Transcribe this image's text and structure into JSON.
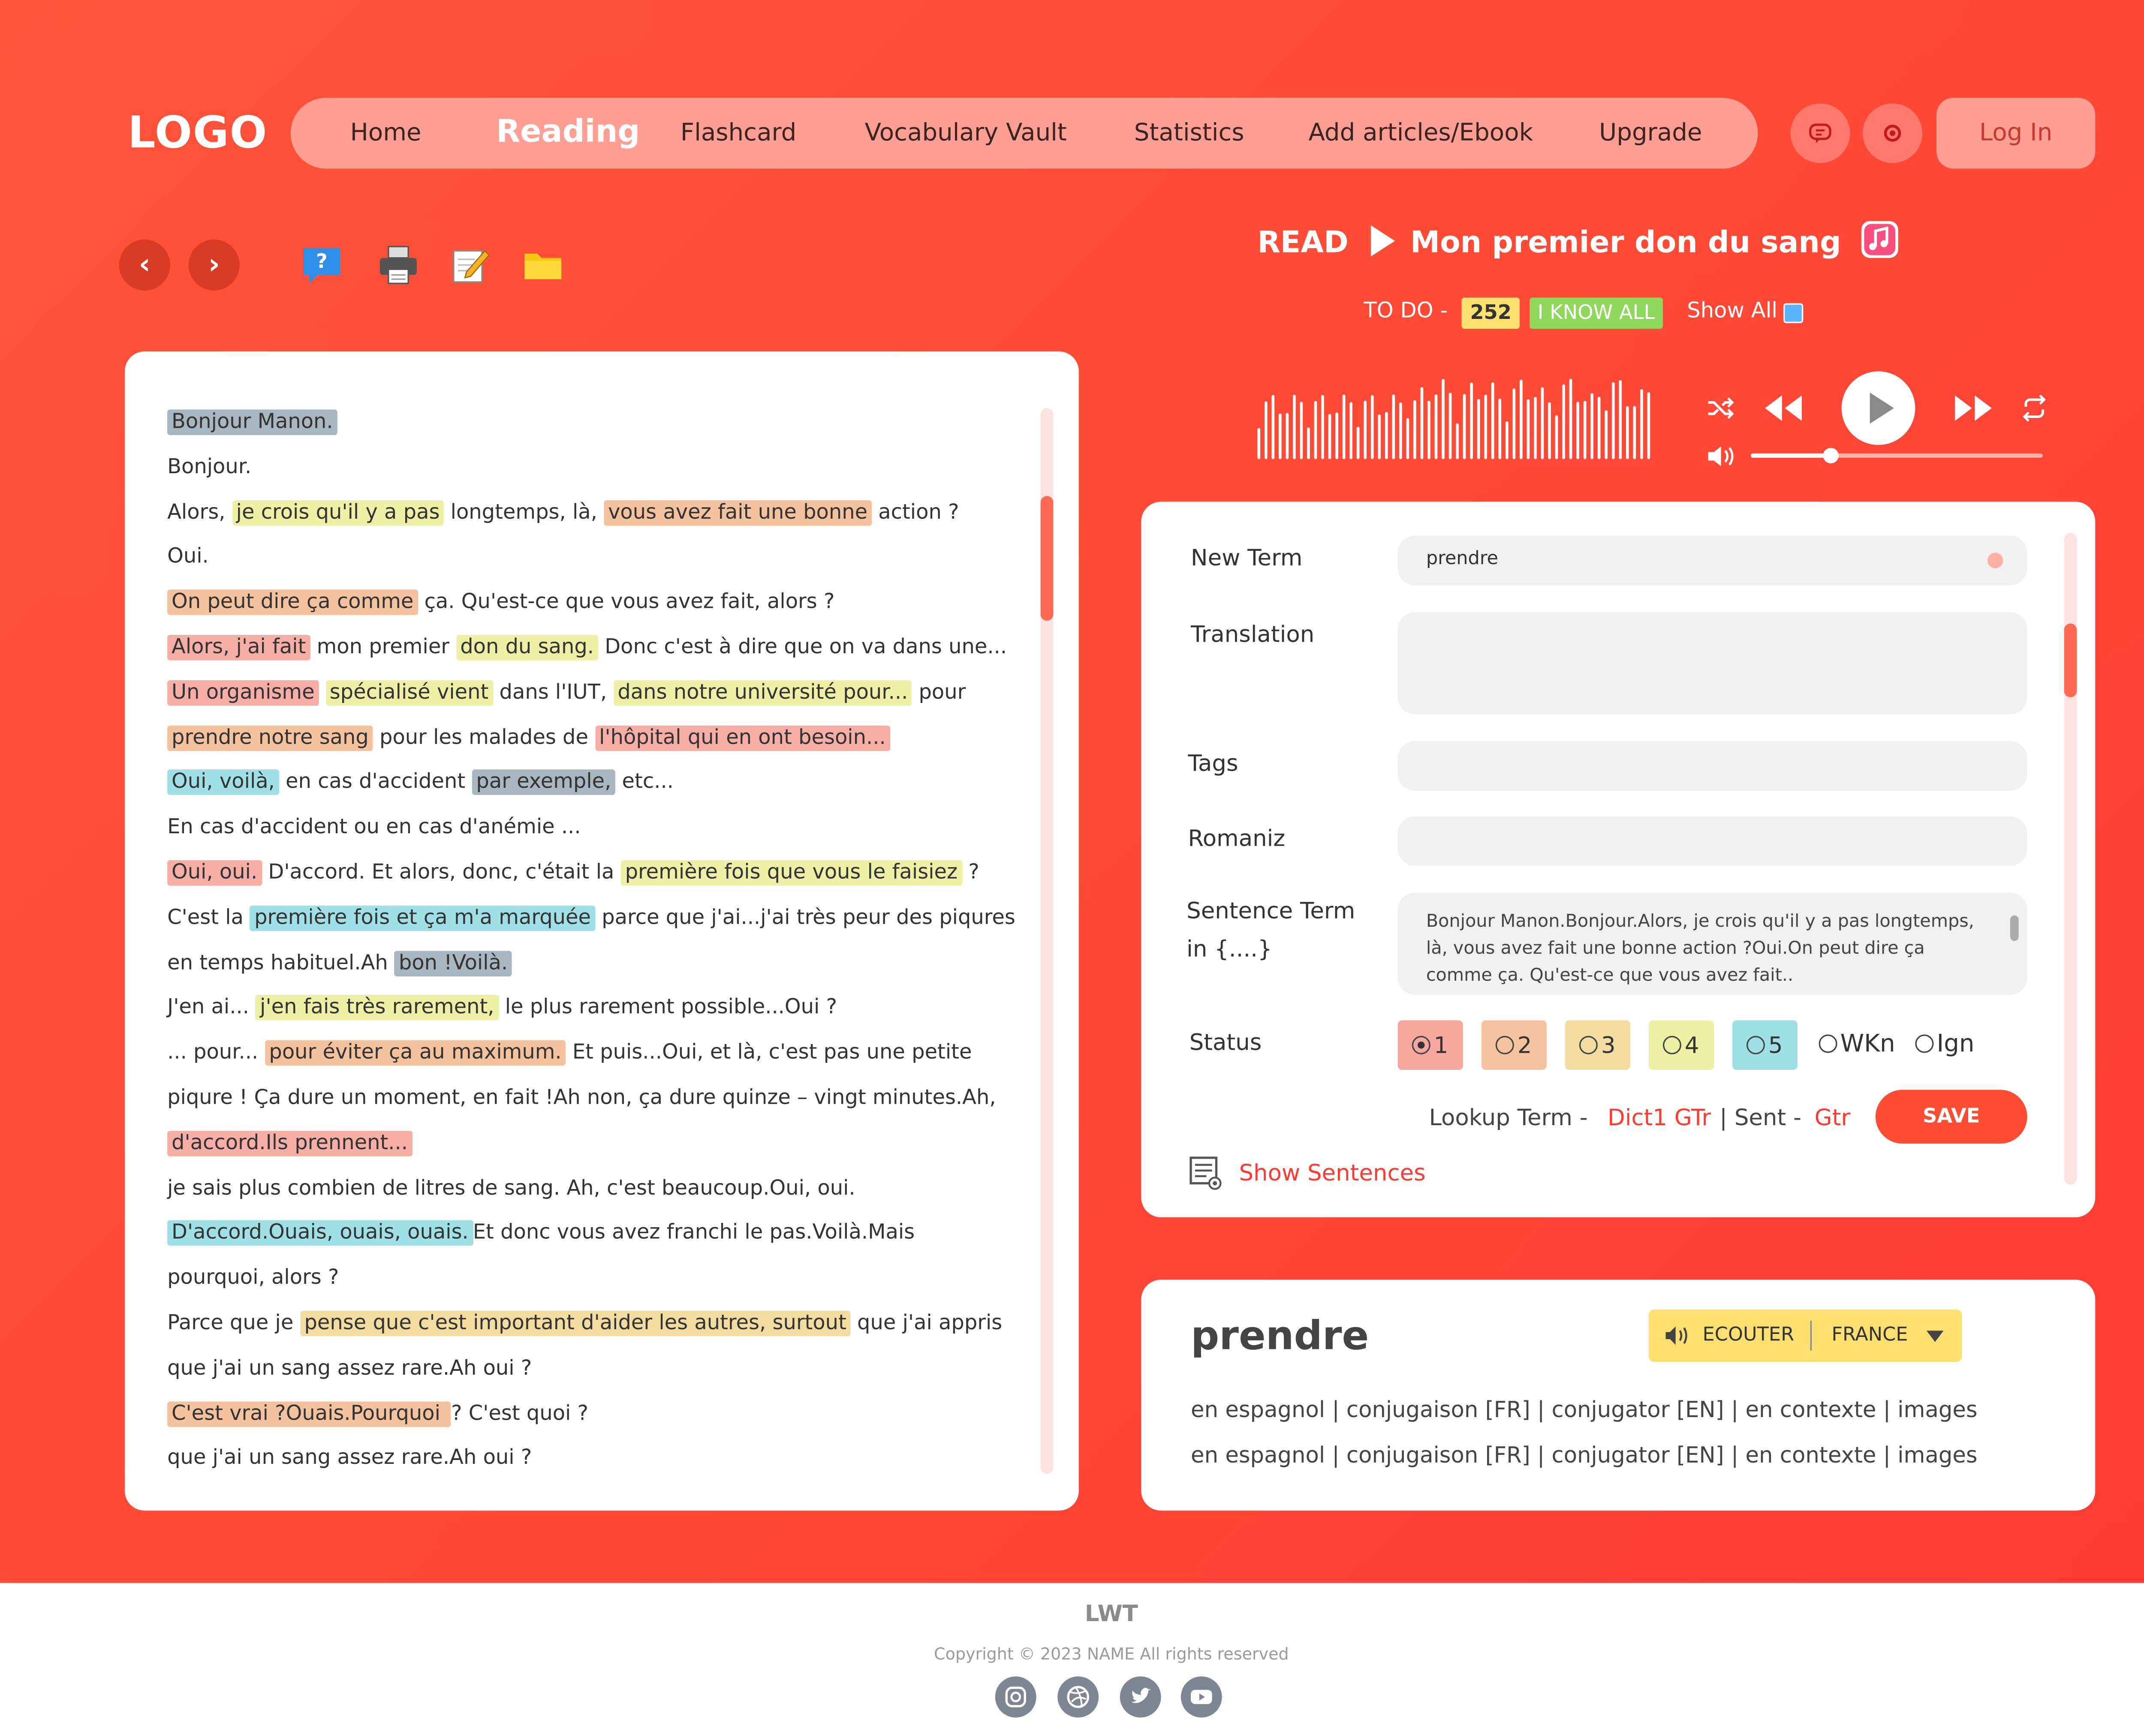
{
  "nav": {
    "logo": "LOGO",
    "items": [
      "Home",
      "Reading",
      "Flashcard",
      "Vocabulary Vault",
      "Statistics",
      "Add articles/Ebook",
      "Upgrade"
    ],
    "active": "Reading",
    "login": "Log In"
  },
  "toolbar": {
    "icons": [
      "prev-arrow-icon",
      "next-arrow-icon",
      "help-icon",
      "printer-icon",
      "edit-icon",
      "folder-icon"
    ]
  },
  "reader": {
    "lines": [
      [
        {
          "t": "Bonjour Manon.",
          "h": "gray"
        }
      ],
      [
        {
          "t": "Bonjour."
        }
      ],
      [
        {
          "t": "Alors, "
        },
        {
          "t": "je crois qu'il y a pas",
          "h": "yellow"
        },
        {
          "t": " longtemps, là, "
        },
        {
          "t": "vous avez fait une bonne",
          "h": "orange"
        },
        {
          "t": " action ?"
        }
      ],
      [
        {
          "t": "Oui."
        }
      ],
      [
        {
          "t": "On peut dire ça comme",
          "h": "orange"
        },
        {
          "t": " ça. Qu'est-ce que vous avez fait, alors ?"
        }
      ],
      [
        {
          "t": "Alors, j'ai fait",
          "h": "pink"
        },
        {
          "t": " mon premier "
        },
        {
          "t": "don du sang.",
          "h": "yellow"
        },
        {
          "t": " Donc c'est à dire que on va dans une..."
        }
      ],
      [
        {
          "t": "Un organisme",
          "h": "pink"
        },
        {
          "t": " "
        },
        {
          "t": "spécialisé vient",
          "h": "yellow"
        },
        {
          "t": " dans l'IUT, "
        },
        {
          "t": "dans notre université pour...",
          "h": "yellow"
        },
        {
          "t": " pour"
        }
      ],
      [
        {
          "t": "prendre notre sang",
          "h": "orange"
        },
        {
          "t": " pour les malades de "
        },
        {
          "t": "l'hôpital qui en ont besoin...",
          "h": "pink"
        }
      ],
      [
        {
          "t": "Oui, voilà,",
          "h": "cyan"
        },
        {
          "t": " en cas d'accident "
        },
        {
          "t": "par exemple,",
          "h": "gray"
        },
        {
          "t": " etc..."
        }
      ],
      [
        {
          "t": "En cas d'accident ou en cas d'anémie ..."
        }
      ],
      [
        {
          "t": "Oui, oui.",
          "h": "pink"
        },
        {
          "t": " D'accord. Et alors, donc, c'était la "
        },
        {
          "t": "première fois que vous le faisiez",
          "h": "yellow"
        },
        {
          "t": " ?"
        }
      ],
      [
        {
          "t": "C'est la "
        },
        {
          "t": "première fois et ça m'a marquée",
          "h": "cyan"
        },
        {
          "t": " parce que j'ai...j'ai très peur des piqures"
        }
      ],
      [
        {
          "t": "en temps habituel.Ah "
        },
        {
          "t": "bon !Voilà.",
          "h": "gray"
        }
      ],
      [
        {
          "t": "J'en ai... "
        },
        {
          "t": "j'en fais très rarement,",
          "h": "yellow"
        },
        {
          "t": " le plus rarement possible...Oui ?"
        }
      ],
      [
        {
          "t": "... pour... "
        },
        {
          "t": "pour éviter ça au maximum.",
          "h": "orange"
        },
        {
          "t": " Et puis...Oui, et là, c'est pas une petite"
        }
      ],
      [
        {
          "t": "piqure ! Ça dure un moment, en fait !Ah non, ça dure quinze – vingt minutes.Ah,"
        }
      ],
      [
        {
          "t": "d'accord.Ils prennent...",
          "h": "pink"
        }
      ],
      [
        {
          "t": " je sais plus combien de litres de sang. Ah, c'est beaucoup.Oui, oui."
        }
      ],
      [
        {
          "t": "D'accord.Ouais, ouais, ouais.",
          "h": "cyan"
        },
        {
          "t": "Et donc vous avez franchi le pas.Voilà.Mais"
        }
      ],
      [
        {
          "t": "pourquoi, alors ?"
        }
      ],
      [
        {
          "t": "Parce que je "
        },
        {
          "t": "pense que c'est important d'aider les autres, surtout",
          "h": "sand"
        },
        {
          "t": " que j'ai appris"
        }
      ],
      [
        {
          "t": "que j'ai un sang assez rare.Ah oui ?"
        }
      ],
      [
        {
          "t": " C'est vrai ?Ouais.Pourquoi ",
          "h": "orange"
        },
        {
          "t": "? C'est quoi ?"
        }
      ],
      [
        {
          "t": "que j'ai un sang assez rare.Ah oui ?"
        }
      ]
    ]
  },
  "player": {
    "read_label": "READ",
    "title": "Mon premier don du sang",
    "todo_label": "TO DO -",
    "todo_count": "252",
    "know_all": "I KNOW ALL",
    "show_all": "Show All",
    "volume": 0.27
  },
  "form": {
    "new_term_label": "New Term",
    "new_term_value": "prendre",
    "translation_label": "Translation",
    "tags_label": "Tags",
    "romaniz_label": "Romaniz",
    "sentence_label_1": "Sentence Term",
    "sentence_label_2": "in {....}",
    "sentence_value": "Bonjour Manon.Bonjour.Alors, je crois qu'il y a pas longtemps, là, vous avez fait une bonne action ?Oui.On peut dire ça comme ça. Qu'est-ce que vous avez fait..",
    "status_label": "Status",
    "status_options": [
      "1",
      "2",
      "3",
      "4",
      "5",
      "WKn",
      "Ign"
    ],
    "status_selected": "1",
    "lookup_label": "Lookup Term -",
    "lookup_links": "Dict1 GTr",
    "sent_label": "| Sent -",
    "sent_link": "Gtr",
    "save": "SAVE",
    "show_sentences": "Show Sentences"
  },
  "dict": {
    "word": "prendre",
    "ecouter": "ECOUTER",
    "language": "FRANCE",
    "links_1": "en espagnol | conjugaison [FR] | conjugator [EN] | en contexte | images",
    "links_2": "en espagnol | conjugaison [FR] | conjugator [EN] | en contexte | images"
  },
  "footer": {
    "title": "LWT",
    "copyright": "Copyright © 2023 NAME All rights reserved",
    "social": [
      "instagram-icon",
      "dribbble-icon",
      "twitter-icon",
      "youtube-icon"
    ]
  },
  "colors": {
    "accent": "#ff4d33",
    "gray_hl": "#a8b6c2",
    "yellow_hl": "#eef0a5",
    "orange_hl": "#f4c29d",
    "pink_hl": "#f7aea4",
    "cyan_hl": "#9fdfe6",
    "sand_hl": "#f2dca0"
  }
}
